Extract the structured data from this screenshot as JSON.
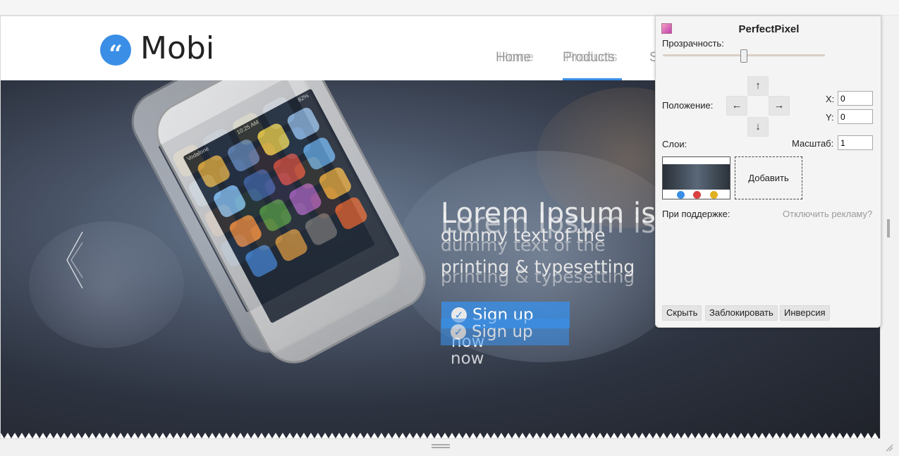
{
  "site": {
    "logo_glyph": "“",
    "logo_text": "Mobi",
    "nav": [
      {
        "label": "Home",
        "ghost": "Home"
      },
      {
        "label": "Products",
        "ghost": "Products"
      },
      {
        "label": "S"
      }
    ],
    "accent_color": "#3a8ee6"
  },
  "hero": {
    "title": "Lorem Ipsum is",
    "subtitle_line1": "dummy text of the",
    "subtitle_line2": "printing & typesetting",
    "cta_label": "Sign up now",
    "phone_status": {
      "carrier": "Vodafone",
      "time": "10:25 AM",
      "battery": "82%"
    }
  },
  "perfectpixel": {
    "title": "PerfectPixel",
    "opacity_label": "Прозрачность:",
    "opacity_level": 0.5,
    "position_label": "Положение:",
    "arrows": {
      "up": "↑",
      "down": "↓",
      "left": "←",
      "right": "→"
    },
    "x_label": "X:",
    "x_value": "0",
    "y_label": "Y:",
    "y_value": "0",
    "layers_label": "Слои:",
    "scale_label": "Масштаб:",
    "scale_value": "1",
    "add_label": "Добавить",
    "support_label": "При поддержке:",
    "disable_ads_label": "Отключить рекламу?",
    "buttons": {
      "hide": "Скрыть",
      "lock": "Заблокировать",
      "invert": "Инверсия"
    }
  }
}
